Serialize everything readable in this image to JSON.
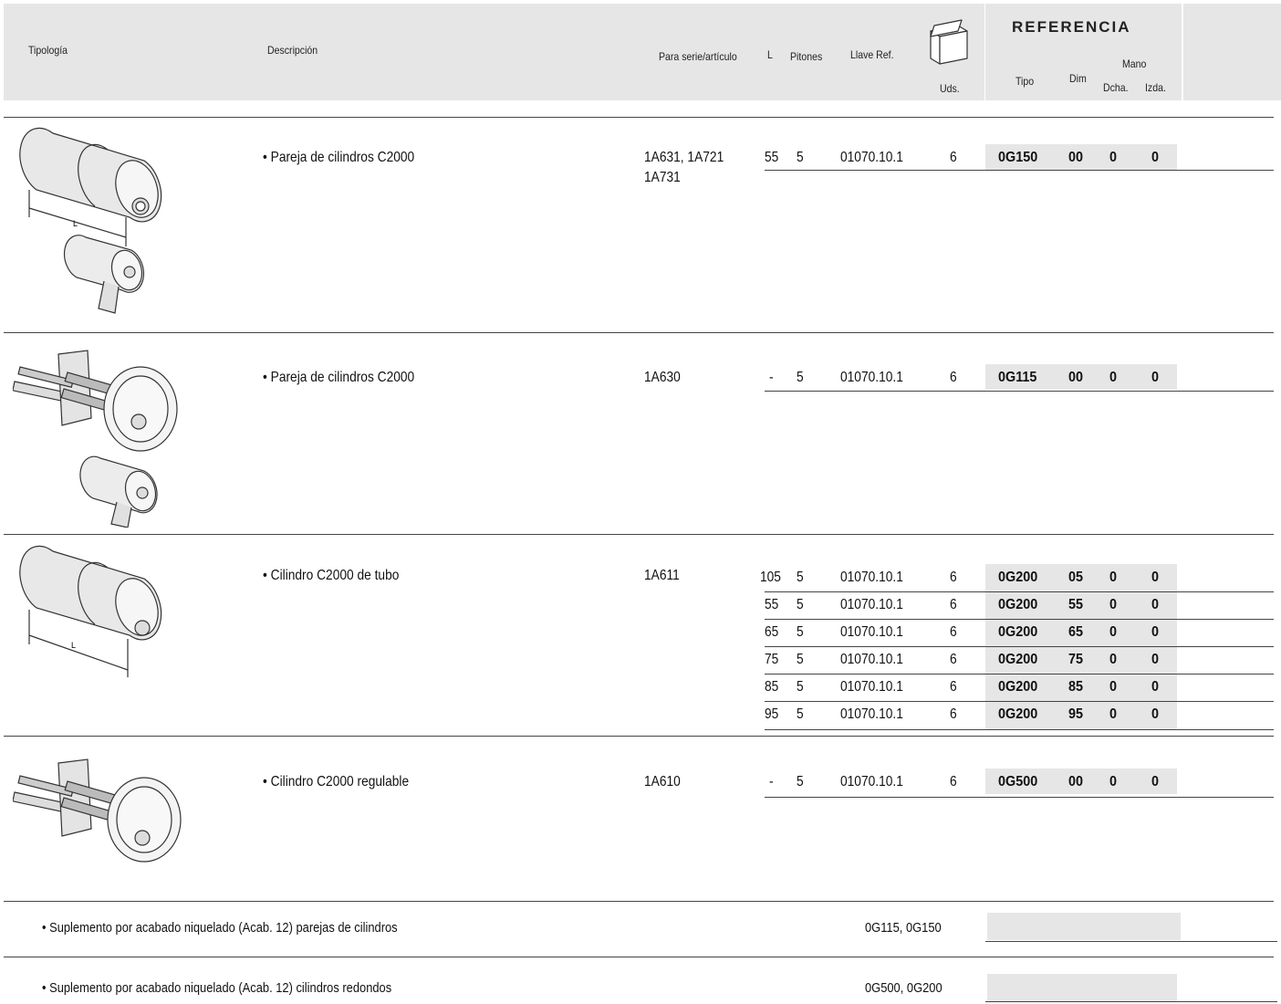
{
  "header": {
    "tipologia": "Tipología",
    "descripcion": "Descripción",
    "para_serie": "Para serie/artículo",
    "l": "L",
    "pitones": "Pitones",
    "llave_ref": "Llave Ref.",
    "uds": "Uds.",
    "referencia": "REFERENCIA",
    "tipo": "Tipo",
    "dim": "Dim",
    "mano": "Mano",
    "dcha": "Dcha.",
    "izda": "Izda."
  },
  "image_labels": {
    "l": "L"
  },
  "products": [
    {
      "description": "• Pareja de cilindros C2000",
      "series": [
        "1A631, 1A721",
        "1A731"
      ],
      "rows": [
        {
          "l": "55",
          "pitones": "5",
          "llave": "01070.10.1",
          "uds": "6",
          "tipo": "0G150",
          "dim": "00",
          "dcha": "0",
          "izda": "0"
        }
      ]
    },
    {
      "description": "• Pareja de cilindros C2000",
      "series": [
        "1A630"
      ],
      "rows": [
        {
          "l": "-",
          "pitones": "5",
          "llave": "01070.10.1",
          "uds": "6",
          "tipo": "0G115",
          "dim": "00",
          "dcha": "0",
          "izda": "0"
        }
      ]
    },
    {
      "description": "• Cilindro C2000 de tubo",
      "series": [
        "1A611"
      ],
      "rows": [
        {
          "l": "105",
          "pitones": "5",
          "llave": "01070.10.1",
          "uds": "6",
          "tipo": "0G200",
          "dim": "05",
          "dcha": "0",
          "izda": "0"
        },
        {
          "l": "55",
          "pitones": "5",
          "llave": "01070.10.1",
          "uds": "6",
          "tipo": "0G200",
          "dim": "55",
          "dcha": "0",
          "izda": "0"
        },
        {
          "l": "65",
          "pitones": "5",
          "llave": "01070.10.1",
          "uds": "6",
          "tipo": "0G200",
          "dim": "65",
          "dcha": "0",
          "izda": "0"
        },
        {
          "l": "75",
          "pitones": "5",
          "llave": "01070.10.1",
          "uds": "6",
          "tipo": "0G200",
          "dim": "75",
          "dcha": "0",
          "izda": "0"
        },
        {
          "l": "85",
          "pitones": "5",
          "llave": "01070.10.1",
          "uds": "6",
          "tipo": "0G200",
          "dim": "85",
          "dcha": "0",
          "izda": "0"
        },
        {
          "l": "95",
          "pitones": "5",
          "llave": "01070.10.1",
          "uds": "6",
          "tipo": "0G200",
          "dim": "95",
          "dcha": "0",
          "izda": "0"
        }
      ]
    },
    {
      "description": "• Cilindro C2000 regulable",
      "series": [
        "1A610"
      ],
      "rows": [
        {
          "l": "-",
          "pitones": "5",
          "llave": "01070.10.1",
          "uds": "6",
          "tipo": "0G500",
          "dim": "00",
          "dcha": "0",
          "izda": "0"
        }
      ]
    }
  ],
  "supplements": [
    {
      "text": "• Suplemento por acabado niquelado (Acab. 12) parejas de cilindros",
      "refs": "0G115, 0G150"
    },
    {
      "text": "• Suplemento por acabado niquelado (Acab. 12) cilindros redondos",
      "refs": "0G500, 0G200"
    }
  ]
}
